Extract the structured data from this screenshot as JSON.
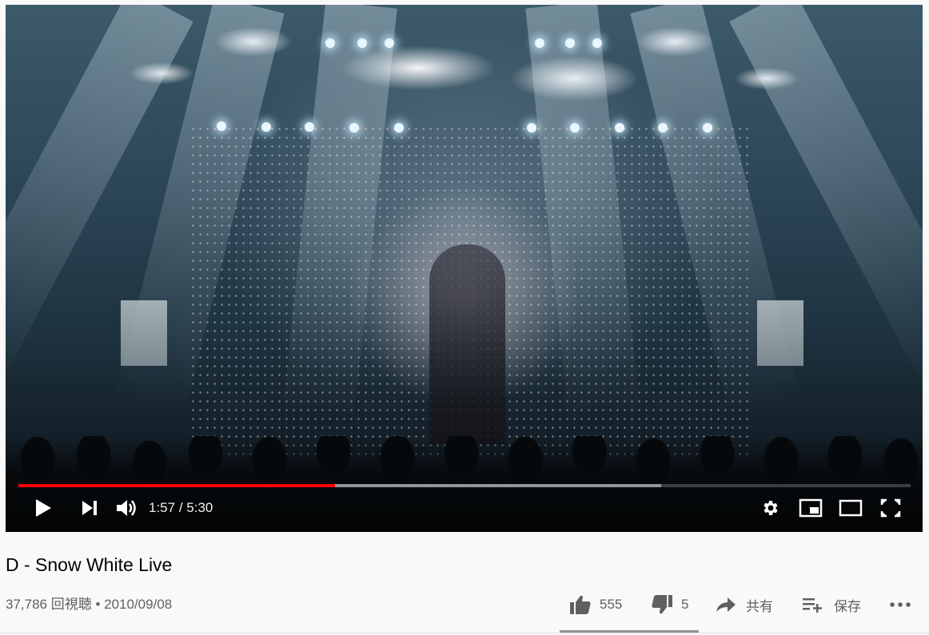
{
  "player": {
    "time_current": "1:57",
    "time_separator": " / ",
    "time_total": "5:30",
    "progress": {
      "played_fraction": 0.355,
      "buffered_fraction": 0.72,
      "played_color": "#ff0000"
    },
    "controls": {
      "play_icon": "play-icon",
      "next_icon": "next-icon",
      "volume_icon": "volume-icon",
      "settings_icon": "gear-icon",
      "miniplayer_icon": "miniplayer-icon",
      "theater_icon": "theater-mode-icon",
      "fullscreen_icon": "fullscreen-icon"
    }
  },
  "video": {
    "title": "D - Snow White Live",
    "views": "37,786 回視聴",
    "separator": " • ",
    "date": "2010/09/08"
  },
  "actions": {
    "like_count": "555",
    "dislike_count": "5",
    "share_label": "共有",
    "save_label": "保存",
    "more_icon": "more-horizontal-icon"
  }
}
